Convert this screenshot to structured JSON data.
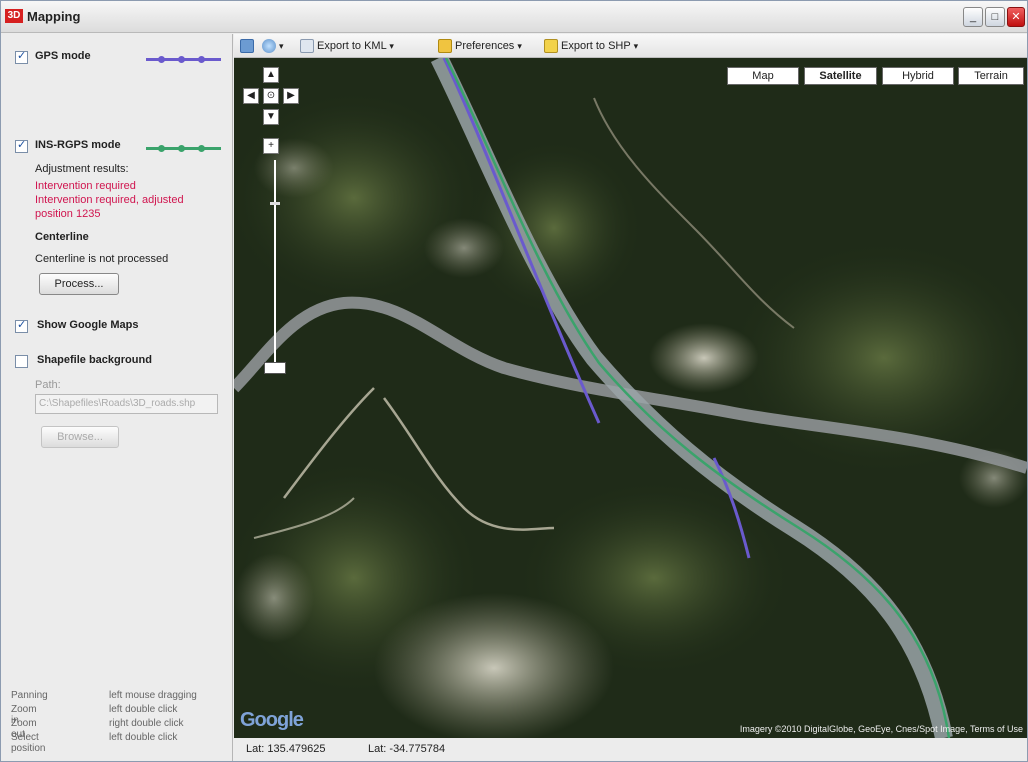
{
  "window": {
    "title": "Mapping",
    "app_icon": "3D",
    "controls": [
      "_",
      "□",
      "✕"
    ]
  },
  "left_panel": {
    "gps_mode": {
      "label": "GPS mode",
      "checked": true,
      "line_color": "#6a5acd"
    },
    "ins_gps_mode": {
      "label": "INS-RGPS mode",
      "checked": true,
      "line_color": "#3aa36b"
    },
    "adjustment_results_label": "Adjustment results:",
    "messages": [
      "Intervention required",
      "Intervention required, adjusted",
      "position 1235"
    ],
    "centerline": {
      "title": "Centerline",
      "status": "Centerline is not processed",
      "process_button": "Process..."
    },
    "show_google_maps": {
      "label": "Show Google Maps",
      "checked": true
    },
    "shapefile_background": {
      "label": "Shapefile background",
      "checked": false
    },
    "path_label": "Path:",
    "path_value": "C:\\Shapefiles\\Roads\\3D_roads.shp",
    "browse_button": "Browse...",
    "help": [
      {
        "action": "Panning",
        "hint": "left mouse dragging"
      },
      {
        "action": "Zoom in",
        "hint": "left double click"
      },
      {
        "action": "Zoom out",
        "hint": "right double click"
      },
      {
        "action": "Select position",
        "hint": "left double click"
      }
    ]
  },
  "toolbar": {
    "items": [
      {
        "label": "",
        "icon": "map-icon"
      },
      {
        "label": "",
        "icon": "globe-icon"
      },
      {
        "label": "Export to KML",
        "icon": "export-icon"
      },
      {
        "label": "Preferences",
        "icon": "preferences-icon"
      },
      {
        "label": "Export to SHP",
        "icon": "export-shp-icon"
      }
    ]
  },
  "map": {
    "map_types": [
      "Map",
      "Satellite",
      "Hybrid",
      "Terrain"
    ],
    "active_map_type": "Satellite",
    "nav": {
      "up": "▲",
      "down": "▼",
      "left": "◀",
      "right": "▶",
      "center": "⊙",
      "zoom_in": "+",
      "zoom_out": "−"
    },
    "zoom_level_fraction": 0.95,
    "logo": "Google",
    "copyright": "Imagery ©2010 DigitalGlobe, GeoEye, Cnes/Spot Image, Terms of Use"
  },
  "status": {
    "lat": "Lat: 135.479625",
    "lon": "Lat: -34.775784"
  }
}
